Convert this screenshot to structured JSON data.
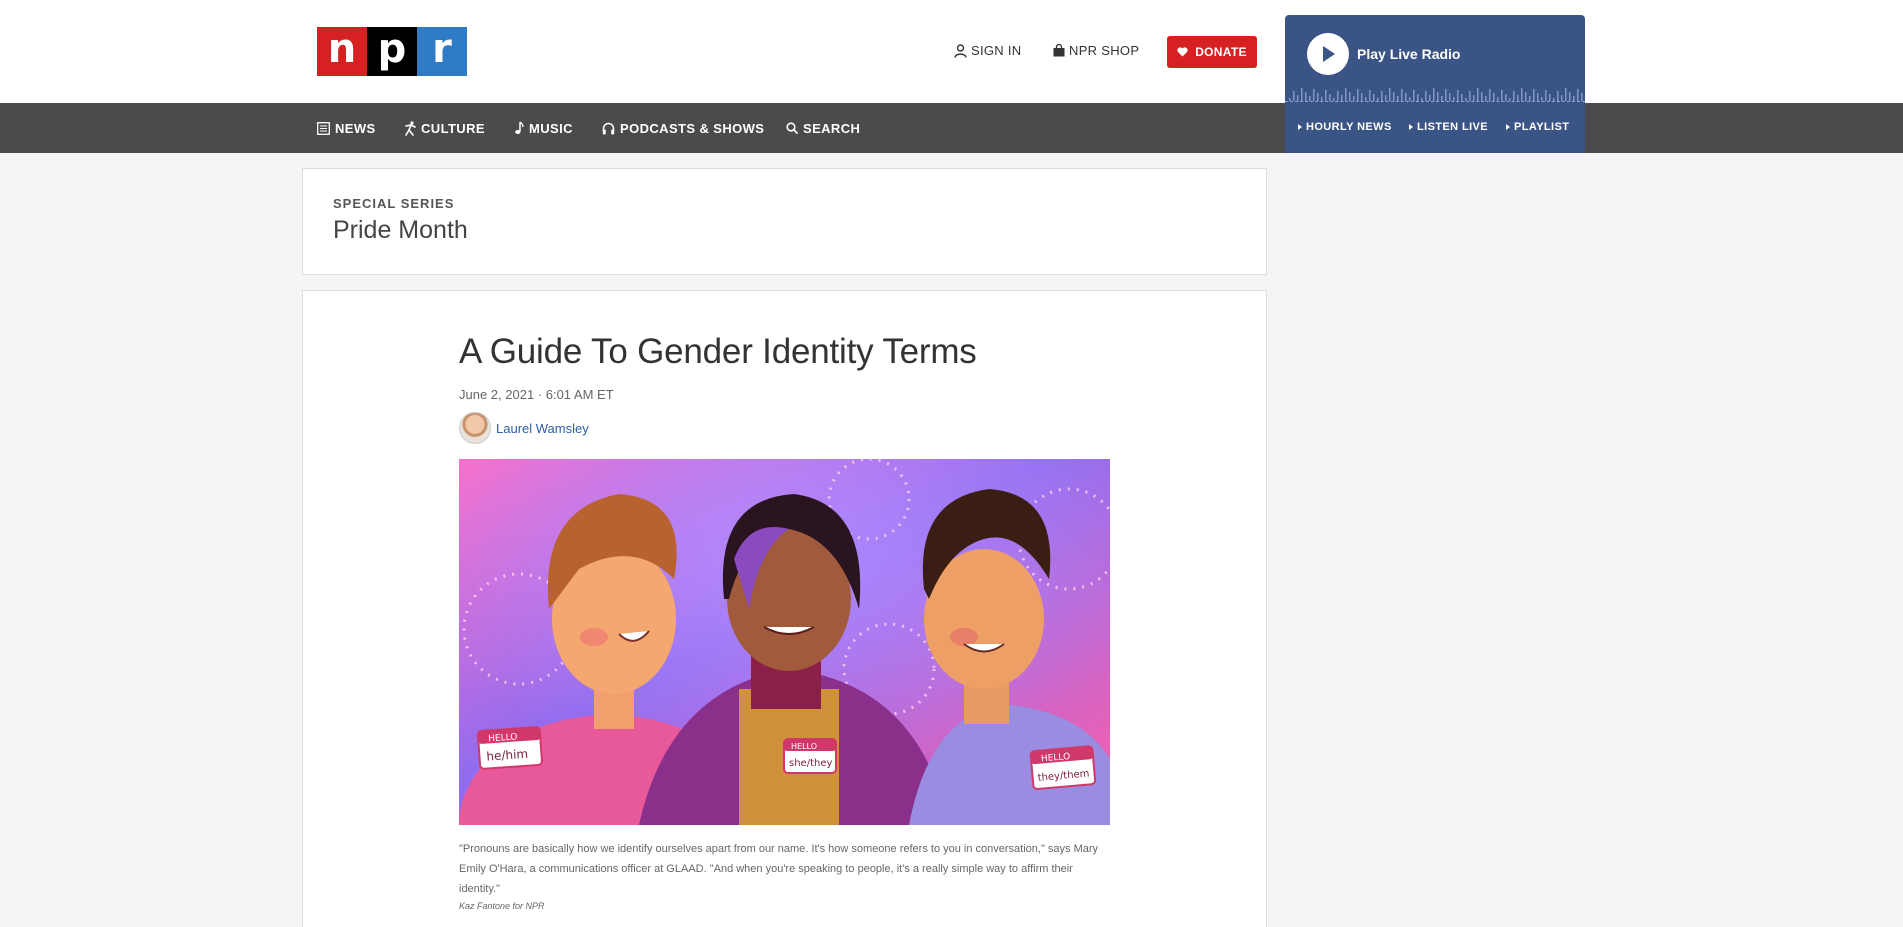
{
  "header": {
    "logo_letters": [
      "n",
      "p",
      "r"
    ],
    "sign_in": "SIGN IN",
    "shop": "NPR SHOP",
    "donate": "DONATE"
  },
  "nav": {
    "items": [
      {
        "label": "NEWS",
        "icon": "news-icon"
      },
      {
        "label": "CULTURE",
        "icon": "culture-icon"
      },
      {
        "label": "MUSIC",
        "icon": "music-note-icon"
      },
      {
        "label": "PODCASTS & SHOWS",
        "icon": "headphones-icon"
      },
      {
        "label": "SEARCH",
        "icon": "search-icon"
      }
    ]
  },
  "radio": {
    "title": "Play Live Radio",
    "links": [
      "HOURLY NEWS",
      "LISTEN LIVE",
      "PLAYLIST"
    ]
  },
  "series": {
    "label": "SPECIAL SERIES",
    "name": "Pride Month"
  },
  "article": {
    "headline": "A Guide To Gender Identity Terms",
    "date": "June 2, 2021 · 6:01 AM ET",
    "author": "Laurel Wamsley",
    "image": {
      "tags": [
        {
          "hello": "HELLO",
          "pronouns": "he/him"
        },
        {
          "hello": "HELLO",
          "pronouns": "she/they"
        },
        {
          "hello": "HELLO",
          "pronouns": "they/them"
        }
      ]
    },
    "caption": "\"Pronouns are basically how we identify ourselves apart from our name. It's how someone refers to you in conversation,\" says Mary Emily O'Hara, a communications officer at GLAAD. \"And when you're speaking to people, it's a really simple way to affirm their identity.\"",
    "credit": "Kaz Fantone for NPR"
  },
  "colors": {
    "npr_red": "#d62021",
    "npr_blue": "#2f7bc6",
    "nav_bg": "#4b4b4b",
    "radio_bg": "#3a5486",
    "link": "#2d5ea8"
  }
}
